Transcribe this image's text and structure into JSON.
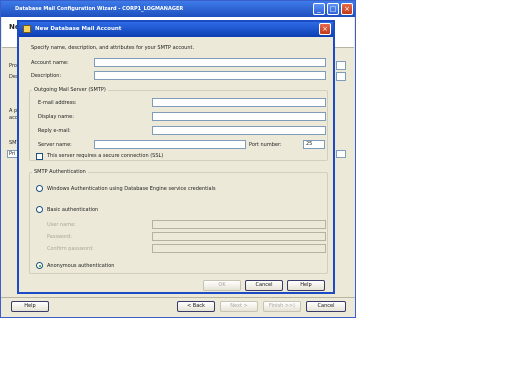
{
  "wizard": {
    "title": "Database Mail Configuration Wizard - CORP1_LOGMANAGER",
    "header_prefix": "Ne",
    "side_labels": [
      "Prof",
      "Desc",
      "A pr",
      "acc",
      "SMT",
      "Pri"
    ],
    "help_label": "Help",
    "back_label": "< Back",
    "next_label": "Next >",
    "finish_label": "Finish >>|",
    "cancel_label": "Cancel"
  },
  "dialog": {
    "title": "New Database Mail Account",
    "icon": "mail-account-icon",
    "intro": "Specify name, description, and attributes for your SMTP account.",
    "account_name_label": "Account name:",
    "account_name_value": "",
    "description_label": "Description:",
    "description_value": "",
    "smtp_group_label": "Outgoing Mail Server (SMTP)",
    "email_label": "E-mail address:",
    "display_name_label": "Display name:",
    "reply_email_label": "Reply e-mail:",
    "server_name_label": "Server name:",
    "port_label": "Port number:",
    "port_value": "25",
    "ssl_label": "This server requires a secure connection (SSL)",
    "auth_group_label": "SMTP Authentication",
    "windows_auth_label": "Windows Authentication using Database Engine service credentials",
    "basic_auth_label": "Basic authentication",
    "user_name_label": "User name:",
    "password_label": "Password:",
    "confirm_password_label": "Confirm password:",
    "anonymous_auth_label": "Anonymous authentication",
    "ok_label": "OK",
    "cancel_label": "Cancel",
    "help_label": "Help"
  }
}
